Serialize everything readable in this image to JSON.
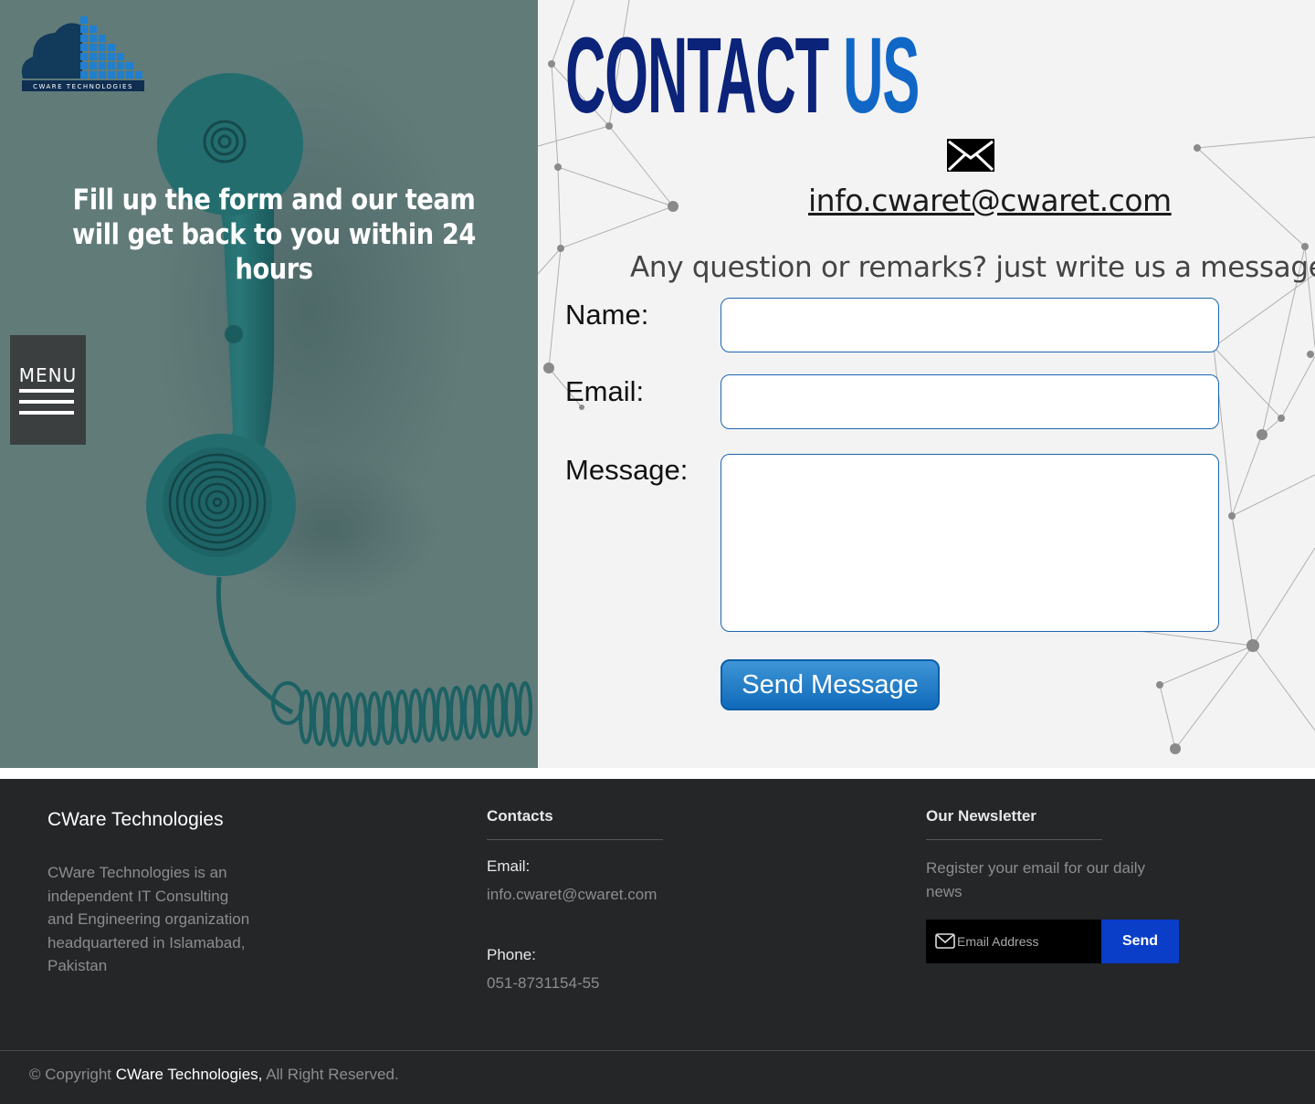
{
  "brand": {
    "logo_text": "CWARE TECHNOLOGIES"
  },
  "hero": {
    "tagline": "Fill up the form and our team will get back to you within 24 hours",
    "menu_label": "MENU"
  },
  "contact": {
    "title_part1": "CONTACT",
    "title_part2": "US",
    "email": "info.cwaret@cwaret.com",
    "subline": "Any question or remarks? just write us a message",
    "name_label": "Name:",
    "email_label": "Email:",
    "message_label": "Message:",
    "name_value": "",
    "email_value": "",
    "message_value": "",
    "submit_label": "Send Message"
  },
  "footer": {
    "company_title": "CWare Technologies",
    "company_desc": "CWare Technologies is an independent IT Consulting and Engineering organization headquartered in Islamabad, Pakistan",
    "contacts_title": "Contacts",
    "email_label": "Email:",
    "email_value": "info.cwaret@cwaret.com",
    "phone_label": "Phone:",
    "phone_value": "051-8731154-55",
    "newsletter_title": "Our Newsletter",
    "newsletter_text": "Register your email for our daily news",
    "newsletter_placeholder": "Email Address",
    "newsletter_send": "Send",
    "copyright_prefix": "© Copyright",
    "copyright_brand": "CWare Technologies,",
    "copyright_suffix": "All Right Reserved."
  },
  "colors": {
    "hero_left_bg": "#617b79",
    "title_dark": "#0b2378",
    "title_light": "#1067c6",
    "button_blue": "#0f6ab9",
    "footer_bg": "#242628",
    "newsletter_send_bg": "#0a3ec9"
  },
  "icons": [
    "logo-icon",
    "menu-icon",
    "mail-icon",
    "envelope-icon"
  ]
}
